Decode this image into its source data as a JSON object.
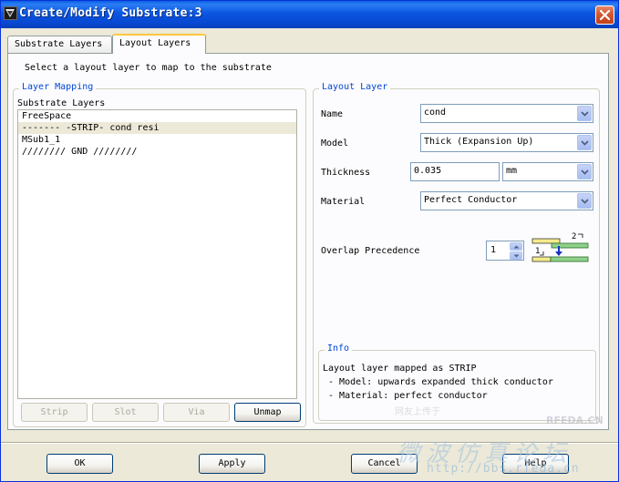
{
  "window": {
    "title": "Create/Modify Substrate:3"
  },
  "tabs": [
    {
      "label": "Substrate Layers",
      "active": false
    },
    {
      "label": "Layout Layers",
      "active": true
    }
  ],
  "instruction": "Select a layout layer to map to the substrate",
  "layer_mapping": {
    "title": "Layer Mapping",
    "list_header": "Substrate Layers",
    "items": [
      {
        "text": "FreeSpace",
        "selected": false
      },
      {
        "text": "------- -STRIP- cond resi",
        "selected": true
      },
      {
        "text": "MSub1_1",
        "selected": false
      },
      {
        "text": "//////// GND ////////",
        "selected": false
      }
    ],
    "buttons": {
      "strip": "Strip",
      "slot": "Slot",
      "via": "Via",
      "unmap": "Unmap"
    }
  },
  "layout_layer": {
    "title": "Layout Layer",
    "name_label": "Name",
    "name_value": "cond",
    "model_label": "Model",
    "model_value": "Thick (Expansion Up)",
    "thickness_label": "Thickness",
    "thickness_value": "0.035",
    "thickness_unit": "mm",
    "material_label": "Material",
    "material_value": "Perfect Conductor",
    "overlap_label": "Overlap Precedence",
    "overlap_value": "1",
    "precedence_icon_labels": [
      "2",
      "1"
    ]
  },
  "info": {
    "title": "Info",
    "lines": [
      "Layout layer mapped as STRIP",
      " - Model: upwards expanded thick conductor",
      " - Material: perfect conductor"
    ]
  },
  "footer": {
    "ok": "OK",
    "apply": "Apply",
    "cancel": "Cancel",
    "help": "Help"
  },
  "watermark": {
    "small_text": "网友上传于",
    "brand": "RFEDA.CN",
    "big_text": "微波仿真论坛",
    "url": "http://bbs.rfeda.cn"
  },
  "colors": {
    "titlebar": "#0a56e0",
    "group_title": "#0046d5",
    "tab_highlight": "#ffc83c"
  }
}
